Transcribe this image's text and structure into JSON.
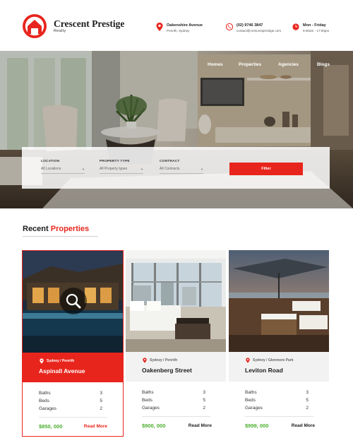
{
  "brand": {
    "name": "Crescent Prestige",
    "sub": "Realty",
    "accent": "#e8251d"
  },
  "contact": [
    {
      "icon": "location-pin-icon",
      "line1": "Oakenshire Avenue",
      "line2": "Penrith, Sydney"
    },
    {
      "icon": "phone-icon",
      "line1": "(02) 9746 3847",
      "line2": "contact@crescentprestige.com"
    },
    {
      "icon": "clock-icon",
      "line1": "Mon - Friday",
      "line2": "9:00am - 17:00pm"
    }
  ],
  "nav": [
    "Homes",
    "Properties",
    "Agencies",
    "Blogs"
  ],
  "search": {
    "fields": [
      {
        "label": "LOCATION",
        "value": "All Locations"
      },
      {
        "label": "PROPERTY TYPE",
        "value": "All Property types"
      },
      {
        "label": "CONTRACT",
        "value": "All Contracts"
      }
    ],
    "button": "Filter"
  },
  "section": {
    "title_a": "Recent",
    "title_b": "Properties"
  },
  "properties": [
    {
      "location": "Sydney / Penrith",
      "title": "Aspinall Avenue",
      "baths_label": "Baths",
      "baths": "3",
      "beds_label": "Beds",
      "beds": "5",
      "garages_label": "Garages",
      "garages": "2",
      "price": "$850, 000",
      "link": "Read More"
    },
    {
      "location": "Sydney / Penrith",
      "title": "Oakenberg Street",
      "baths_label": "Baths",
      "baths": "3",
      "beds_label": "Beds",
      "beds": "5",
      "garages_label": "Garages",
      "garages": "2",
      "price": "$900, 000",
      "link": "Read More"
    },
    {
      "location": "Sydney / Glenmore Park",
      "title": "Leviton Road",
      "baths_label": "Baths",
      "baths": "3",
      "beds_label": "Beds",
      "beds": "5",
      "garages_label": "Garages",
      "garages": "2",
      "price": "$999, 000",
      "link": "Read More"
    }
  ]
}
